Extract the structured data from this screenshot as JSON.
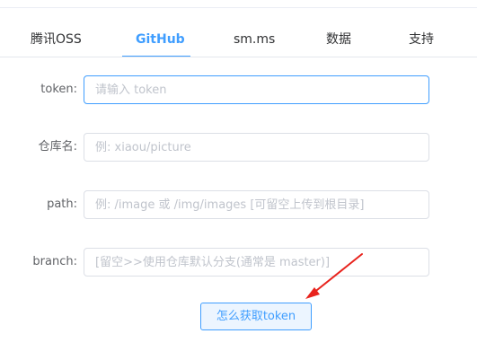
{
  "tabs": [
    {
      "label": "腾讯OSS",
      "active": false
    },
    {
      "label": "GitHub",
      "active": true
    },
    {
      "label": "sm.ms",
      "active": false
    },
    {
      "label": "数据",
      "active": false
    },
    {
      "label": "支持",
      "active": false
    }
  ],
  "form": {
    "token": {
      "label": "token:",
      "value": "",
      "placeholder": "请输入 token"
    },
    "repo": {
      "label": "仓库名:",
      "value": "",
      "placeholder": "例: xiaou/picture"
    },
    "path": {
      "label": "path:",
      "value": "",
      "placeholder": "例: /image 或 /img/images [可留空上传到根目录]"
    },
    "branch": {
      "label": "branch:",
      "value": "",
      "placeholder": "[留空>>使用仓库默认分支(通常是 master)]"
    }
  },
  "help_button": {
    "label": "怎么获取token"
  },
  "colors": {
    "accent": "#409eff",
    "annotation_arrow": "#e8231d"
  },
  "icons": {
    "annotation": "red-arrow-icon"
  }
}
